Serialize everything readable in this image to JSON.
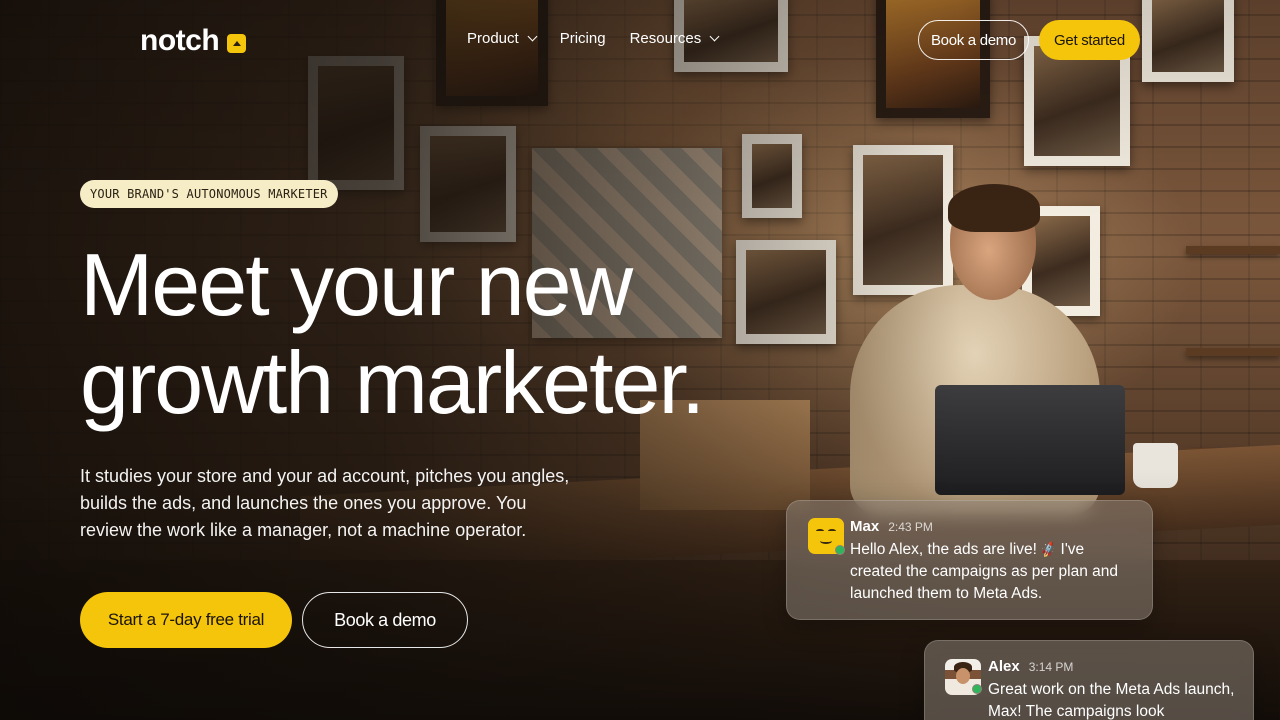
{
  "nav": {
    "logo_text": "notch",
    "menu": [
      {
        "label": "Product",
        "has_dropdown": true
      },
      {
        "label": "Pricing",
        "has_dropdown": false
      },
      {
        "label": "Resources",
        "has_dropdown": true
      }
    ],
    "book_demo_label": "Book a demo",
    "get_started_label": "Get started"
  },
  "hero": {
    "eyebrow": "YOUR BRAND'S AUTONOMOUS MARKETER",
    "headline_line1": "Meet your new",
    "headline_line2": "growth marketer.",
    "subcopy": "It studies your store and your ad account, pitches you angles, builds the ads, and launches the ones you approve. You review the work like a manager, not a machine operator.",
    "cta_primary": "Start a 7-day free trial",
    "cta_secondary": "Book a demo"
  },
  "chat": [
    {
      "name": "Max",
      "time": "2:43 PM",
      "text_before_emoji": "Hello Alex, the ads are live! ",
      "emoji": "🚀",
      "text_after_emoji": " I've created the campaigns as per plan and launched them to Meta Ads.",
      "avatar_icon": "smiley-avatar-icon",
      "status": "online"
    },
    {
      "name": "Alex",
      "time": "3:14 PM",
      "text": "Great work on the Meta Ads launch, Max! The campaigns look",
      "avatar_icon": "person-avatar-icon",
      "status": "online"
    }
  ],
  "colors": {
    "accent": "#f5c50b",
    "eyebrow_bg": "#f6ecc6",
    "online": "#2fb55a"
  }
}
